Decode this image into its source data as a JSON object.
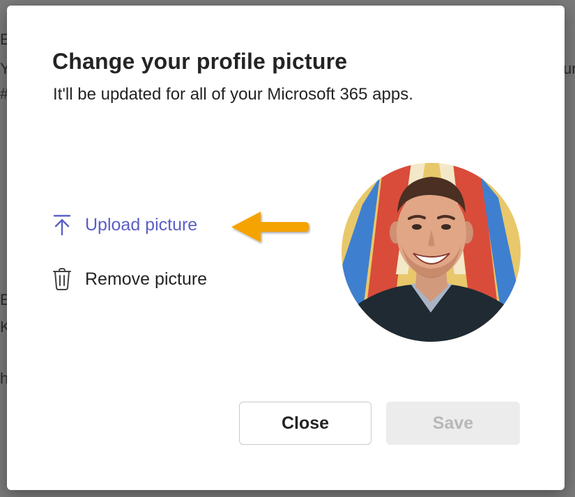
{
  "dialog": {
    "title": "Change your profile picture",
    "subtitle": "It'll be updated for all of your Microsoft 365 apps."
  },
  "actions": {
    "upload_label": "Upload picture",
    "remove_label": "Remove picture"
  },
  "buttons": {
    "close_label": "Close",
    "save_label": "Save"
  },
  "background_fragments": [
    "E",
    "Y",
    "#",
    "ur",
    "E",
    "K",
    "h"
  ],
  "icons": {
    "upload": "upload-arrow-icon",
    "remove": "trash-icon",
    "annotation": "orange-arrow"
  },
  "colors": {
    "accent": "#5b5fc7",
    "annotation_arrow": "#f5a300",
    "text": "#242424",
    "disabled_text": "#b8b8b8",
    "disabled_bg": "#ececec"
  }
}
